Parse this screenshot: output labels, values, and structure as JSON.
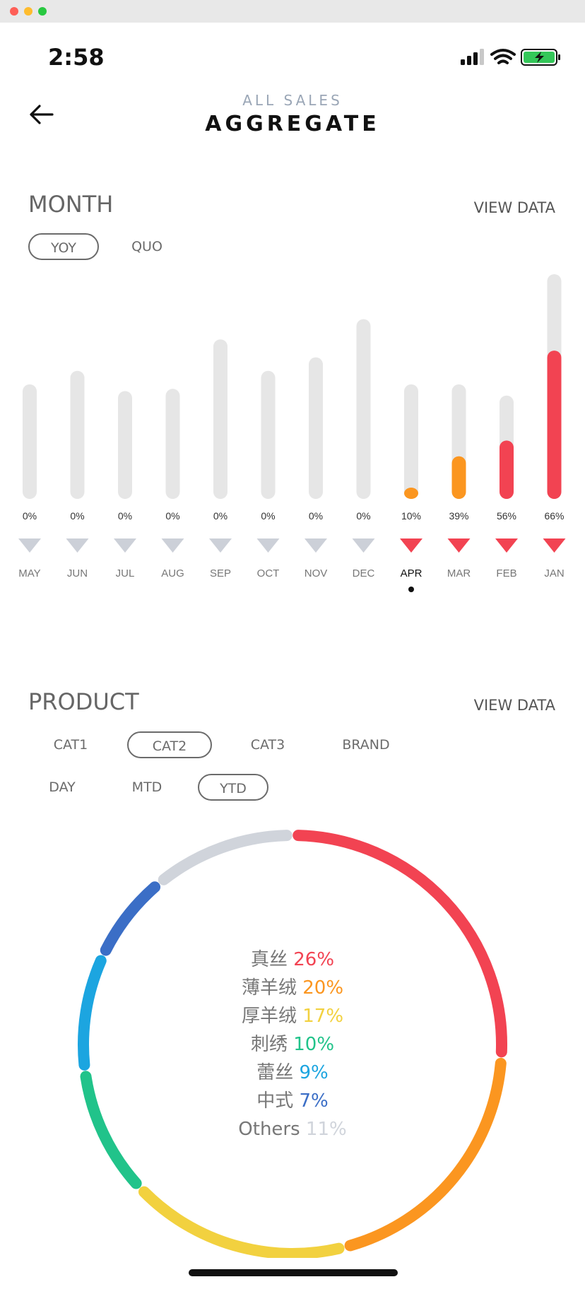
{
  "window": {},
  "status": {
    "time": "2:58"
  },
  "header": {
    "subtitle": "ALL SALES",
    "title": "AGGREGATE"
  },
  "month_section": {
    "title": "MONTH",
    "view_data": "VIEW DATA",
    "toggles": [
      {
        "label": "YOY",
        "active": true
      },
      {
        "label": "QUO",
        "active": false
      }
    ],
    "selected_month": "APR"
  },
  "product_section": {
    "title": "PRODUCT",
    "view_data": "VIEW DATA",
    "categories": [
      {
        "label": "CAT1",
        "active": false
      },
      {
        "label": "CAT2",
        "active": true
      },
      {
        "label": "CAT3",
        "active": false
      },
      {
        "label": "BRAND",
        "active": false
      }
    ],
    "periods": [
      {
        "label": "DAY",
        "active": false
      },
      {
        "label": "MTD",
        "active": false
      },
      {
        "label": "YTD",
        "active": true
      }
    ]
  },
  "colors": {
    "accent_red": "#f24352",
    "accent_orange": "#fb9620",
    "track_gray": "#e6e6e6",
    "arrow_gray": "#ccd0d8"
  },
  "chart_data": [
    {
      "type": "bar",
      "categories": [
        "MAY",
        "JUN",
        "JUL",
        "AUG",
        "SEP",
        "OCT",
        "NOV",
        "DEC",
        "APR",
        "MAR",
        "FEB",
        "JAN"
      ],
      "labels": [
        "0%",
        "0%",
        "0%",
        "0%",
        "0%",
        "0%",
        "0%",
        "0%",
        "10%",
        "39%",
        "56%",
        "66%"
      ],
      "track_values": [
        51,
        57,
        48,
        49,
        71,
        57,
        63,
        80,
        51,
        51,
        46,
        100
      ],
      "fill_values": [
        0,
        0,
        0,
        0,
        0,
        0,
        0,
        0,
        4,
        19,
        26,
        66
      ],
      "fill_colors": [
        "#f24352",
        "#f24352",
        "#f24352",
        "#f24352",
        "#f24352",
        "#f24352",
        "#f24352",
        "#f24352",
        "#fb9620",
        "#fb9620",
        "#f24352",
        "#f24352"
      ],
      "arrow_colors": [
        "#ccd0d8",
        "#ccd0d8",
        "#ccd0d8",
        "#ccd0d8",
        "#ccd0d8",
        "#ccd0d8",
        "#ccd0d8",
        "#ccd0d8",
        "#f24352",
        "#f24352",
        "#f24352",
        "#f24352"
      ]
    },
    {
      "type": "pie",
      "slices": [
        {
          "name": "真丝",
          "label": "26%",
          "value": 26,
          "color": "#f24352"
        },
        {
          "name": "薄羊绒",
          "label": "20%",
          "value": 20,
          "color": "#fb9620"
        },
        {
          "name": "厚羊绒",
          "label": "17%",
          "value": 17,
          "color": "#f2d13f"
        },
        {
          "name": "刺绣",
          "label": "10%",
          "value": 10,
          "color": "#21c38a"
        },
        {
          "name": "蕾丝",
          "label": "9%",
          "value": 9,
          "color": "#1ca5e0"
        },
        {
          "name": "中式",
          "label": "7%",
          "value": 7,
          "color": "#3b6ec6"
        },
        {
          "name": "Others",
          "label": "11%",
          "value": 11,
          "color": "#d0d4db"
        }
      ]
    }
  ]
}
